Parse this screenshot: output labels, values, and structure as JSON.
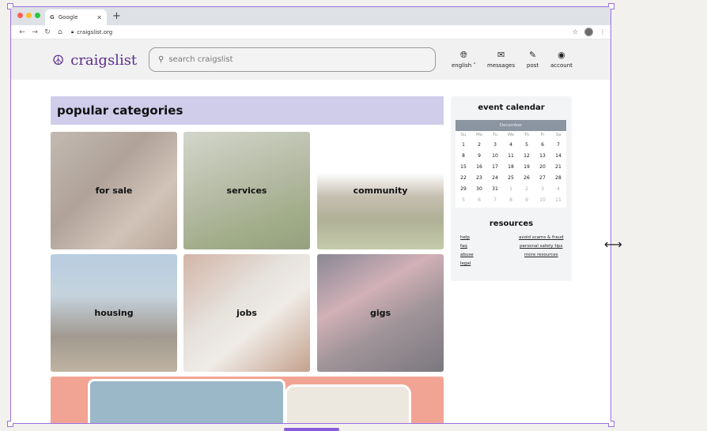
{
  "browser": {
    "tab_title": "Google",
    "tab_favicon": "G",
    "url": "craigslist.org",
    "traffic_light_colors": [
      "#ff5f57",
      "#febc2e",
      "#28c840"
    ]
  },
  "header": {
    "logo_text": "craigslist",
    "search_placeholder": "search craigslist",
    "nav": [
      {
        "icon": "globe-icon",
        "label": "english"
      },
      {
        "icon": "envelope-icon",
        "label": "messages"
      },
      {
        "icon": "pencil-icon",
        "label": "post"
      },
      {
        "icon": "account-icon",
        "label": "account"
      }
    ]
  },
  "main": {
    "categories_title": "popular categories",
    "tiles": [
      {
        "label": "for sale"
      },
      {
        "label": "services"
      },
      {
        "label": "community"
      },
      {
        "label": "housing"
      },
      {
        "label": "jobs"
      },
      {
        "label": "gigs"
      }
    ]
  },
  "sidebar": {
    "calendar_title": "event calendar",
    "month": "December",
    "weekdays": [
      "Su",
      "Mo",
      "Tu",
      "We",
      "Th",
      "Fr",
      "Sa"
    ],
    "days": [
      [
        "1",
        "2",
        "3",
        "4",
        "5",
        "6",
        "7"
      ],
      [
        "8",
        "9",
        "10",
        "11",
        "12",
        "13",
        "14"
      ],
      [
        "15",
        "16",
        "17",
        "18",
        "19",
        "20",
        "21"
      ],
      [
        "22",
        "23",
        "24",
        "25",
        "26",
        "27",
        "28"
      ],
      [
        "29",
        "30",
        "31",
        "1",
        "2",
        "3",
        "4"
      ],
      [
        "5",
        "6",
        "7",
        "8",
        "9",
        "10",
        "11"
      ]
    ],
    "resources_title": "resources",
    "resources_left": [
      "help",
      "faq",
      "abuse",
      "legal"
    ],
    "resources_right": [
      "avoid scams & fraud",
      "personal safety tips",
      "more resources"
    ]
  },
  "colors": {
    "accent": "#5b2c8f",
    "category_header_bg": "#d0cdeb",
    "selection_frame": "#9b6fe0"
  }
}
